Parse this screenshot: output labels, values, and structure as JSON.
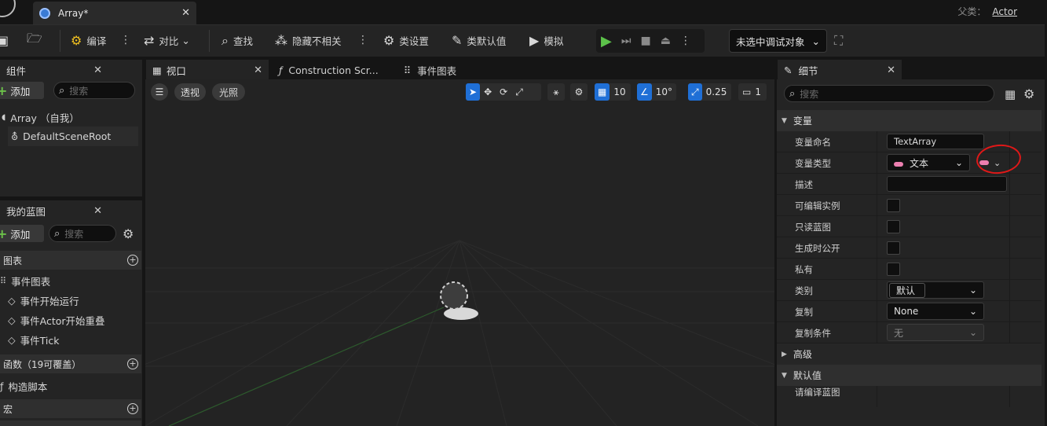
{
  "titlebar": {
    "doc_tab": "Array*",
    "parent_label": "父类：",
    "parent_value": "Actor"
  },
  "toolbar": {
    "compile": "编译",
    "diff": "对比",
    "find": "查找",
    "hide_unrelated": "隐藏不相关",
    "class_settings": "类设置",
    "class_defaults": "类默认值",
    "simulate": "模拟",
    "debug_target": "未选中调试对象"
  },
  "components": {
    "tab": "组件",
    "add": "添加",
    "search_placeholder": "搜索",
    "root": "Array （自我）",
    "child": "DefaultSceneRoot"
  },
  "my_blueprint": {
    "tab": "我的蓝图",
    "add": "添加",
    "search_placeholder": "搜索",
    "graphs_header": "图表",
    "event_graph": "事件图表",
    "events": [
      "事件开始运行",
      "事件Actor开始重叠",
      "事件Tick"
    ],
    "functions_header": "函数（19可覆盖）",
    "construction": "构造脚本",
    "macros_header": "宏"
  },
  "center_tabs": {
    "viewport": "视口",
    "construction": "Construction Scr...",
    "event_graph": "事件图表"
  },
  "viewport": {
    "perspective": "透视",
    "lit": "光照",
    "grid_snap": "10",
    "rot_snap": "10°",
    "scale_snap": "0.25",
    "cam_speed": "1"
  },
  "details": {
    "tab": "细节",
    "search_placeholder": "搜索",
    "section_variable": "变量",
    "rows": {
      "name_label": "变量命名",
      "name_value": "TextArray",
      "type_label": "变量类型",
      "type_value": "文本",
      "desc_label": "描述",
      "editable_label": "可编辑实例",
      "readonly_label": "只读蓝图",
      "expose_label": "生成时公开",
      "private_label": "私有",
      "category_label": "类别",
      "category_value": "默认",
      "replication_label": "复制",
      "replication_value": "None",
      "rep_cond_label": "复制条件",
      "rep_cond_value": "无"
    },
    "section_advanced": "高级",
    "section_default": "默认值",
    "compile_hint": "请编译蓝图"
  },
  "colors": {
    "accent": "#1f6fd6",
    "text_pin": "#ec7fb0",
    "play_green": "#5cc24a",
    "annotation_red": "#e01818"
  }
}
